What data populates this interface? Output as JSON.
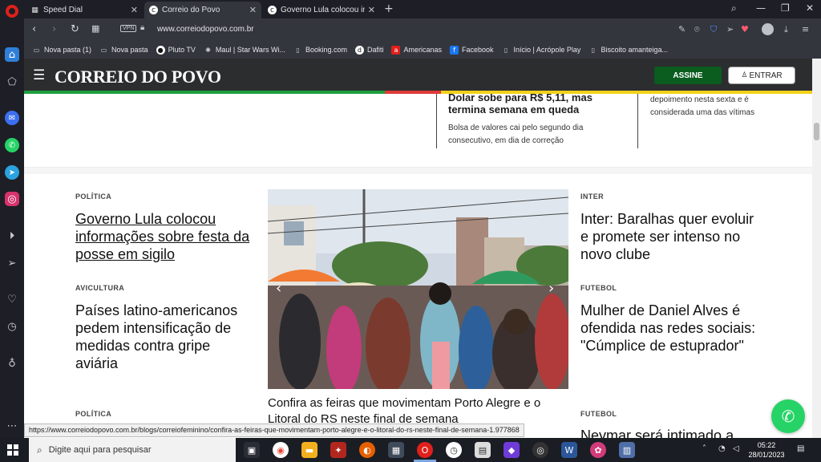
{
  "browser": {
    "tabs": [
      {
        "label": "Speed Dial",
        "icon": "speed-dial-icon"
      },
      {
        "label": "Correio do Povo",
        "icon": "correio-favicon"
      },
      {
        "label": "Governo Lula colocou inform",
        "icon": "correio-favicon"
      }
    ],
    "url": "www.correiodopovo.com.br",
    "vpn_label": "VPN",
    "bookmarks": [
      {
        "label": "Nova pasta (1)",
        "icon": "folder-icon"
      },
      {
        "label": "Nova pasta",
        "icon": "folder-icon"
      },
      {
        "label": "Pluto TV",
        "icon": "pluto-tv-icon"
      },
      {
        "label": "Maul | Star Wars Wi...",
        "icon": "star-wars-icon"
      },
      {
        "label": "Booking.com",
        "icon": "page-icon"
      },
      {
        "label": "Dafiti",
        "icon": "dafiti-icon"
      },
      {
        "label": "Americanas",
        "icon": "americanas-icon"
      },
      {
        "label": "Facebook",
        "icon": "facebook-icon"
      },
      {
        "label": "Início | Acrópole Play",
        "icon": "page-icon"
      },
      {
        "label": "Biscoito amanteiga...",
        "icon": "page-icon"
      }
    ]
  },
  "site": {
    "logo": "CORREIO DO POVO",
    "subscribe_label": "ASSINE",
    "login_label": "ENTRAR",
    "stripe_colors": [
      "#1f9f3f",
      "#e03a3a",
      "#f2d21c"
    ]
  },
  "top_stories": {
    "left_title": "Dolar sobe para R$ 5,11, mas termina semana em queda",
    "left_desc": "Bolsa de valores cai pelo segundo dia consecutivo, em dia de correção",
    "right_desc": "depoimento nesta sexta e é considerada uma das vítimas"
  },
  "articles": {
    "left": [
      {
        "category": "POLÍTICA",
        "title": "Governo Lula colocou informações sobre festa da posse em sigilo"
      },
      {
        "category": "AVICULTURA",
        "title": "Países latino-americanos pedem intensificação de medidas contra gripe aviária"
      },
      {
        "category": "POLÍTICA",
        "title": ""
      }
    ],
    "feature": {
      "caption": "Confira as feiras que movimentam Porto Alegre e o Litoral do RS neste final de semana"
    },
    "right": [
      {
        "category": "INTER",
        "title": "Inter: Baralhas quer evoluir e promete ser intenso no novo clube"
      },
      {
        "category": "FUTEBOL",
        "title": "Mulher de Daniel Alves é ofendida nas redes sociais: \"Cúmplice de estuprador\""
      },
      {
        "category": "FUTEBOL",
        "title": "Neymar será intimado a"
      }
    ]
  },
  "status_url": "https://www.correiodopovo.com.br/blogs/correiofeminino/confira-as-feiras-que-movimentam-porto-alegre-e-o-litoral-do-rs-neste-final-de-semana-1.977868",
  "taskbar": {
    "search_placeholder": "Digite aqui para pesquisar",
    "time": "05:22",
    "date": "28/01/2023"
  }
}
